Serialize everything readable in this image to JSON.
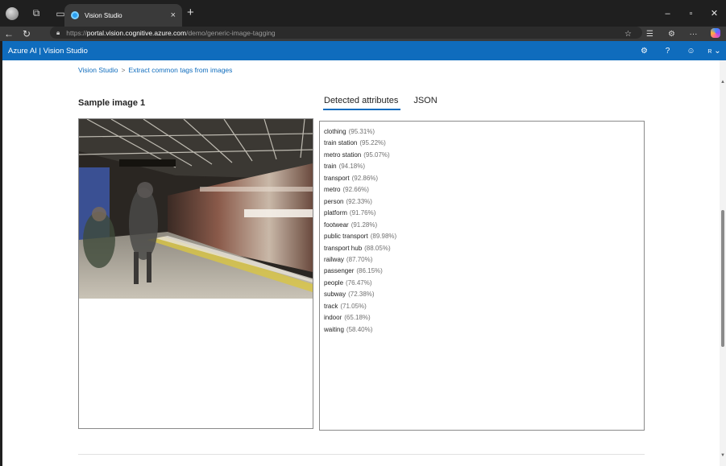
{
  "browser": {
    "tab_title": "Vision Studio",
    "tab_close": "×",
    "new_tab": "+",
    "url_scheme": "https://",
    "url_host": "portal.vision.cognitive.azure.com",
    "url_path": "/demo/generic-image-tagging",
    "window_controls": [
      "–",
      "▫",
      "✕"
    ]
  },
  "appbar": {
    "brand": "Azure AI | Vision Studio",
    "user_initial": "R"
  },
  "breadcrumb": {
    "root": "Vision Studio",
    "separator": ">",
    "current": "Extract common tags from images"
  },
  "sample": {
    "title": "Sample image 1"
  },
  "result_tabs": [
    {
      "label": "Detected attributes",
      "active": true
    },
    {
      "label": "JSON",
      "active": false
    }
  ],
  "attributes": [
    {
      "name": "clothing",
      "confidence": "(95.31%)"
    },
    {
      "name": "train station",
      "confidence": "(95.22%)"
    },
    {
      "name": "metro station",
      "confidence": "(95.07%)"
    },
    {
      "name": "train",
      "confidence": "(94.18%)"
    },
    {
      "name": "transport",
      "confidence": "(92.86%)"
    },
    {
      "name": "metro",
      "confidence": "(92.66%)"
    },
    {
      "name": "person",
      "confidence": "(92.33%)"
    },
    {
      "name": "platform",
      "confidence": "(91.76%)"
    },
    {
      "name": "footwear",
      "confidence": "(91.28%)"
    },
    {
      "name": "public transport",
      "confidence": "(89.98%)"
    },
    {
      "name": "transport hub",
      "confidence": "(88.05%)"
    },
    {
      "name": "railway",
      "confidence": "(87.70%)"
    },
    {
      "name": "passenger",
      "confidence": "(86.15%)"
    },
    {
      "name": "people",
      "confidence": "(76.47%)"
    },
    {
      "name": "subway",
      "confidence": "(72.38%)"
    },
    {
      "name": "track",
      "confidence": "(71.05%)"
    },
    {
      "name": "indoor",
      "confidence": "(65.18%)"
    },
    {
      "name": "waiting",
      "confidence": "(58.40%)"
    }
  ],
  "colors": {
    "azure_blue": "#0f6cbd",
    "browser_dark": "#1f1f1f"
  }
}
